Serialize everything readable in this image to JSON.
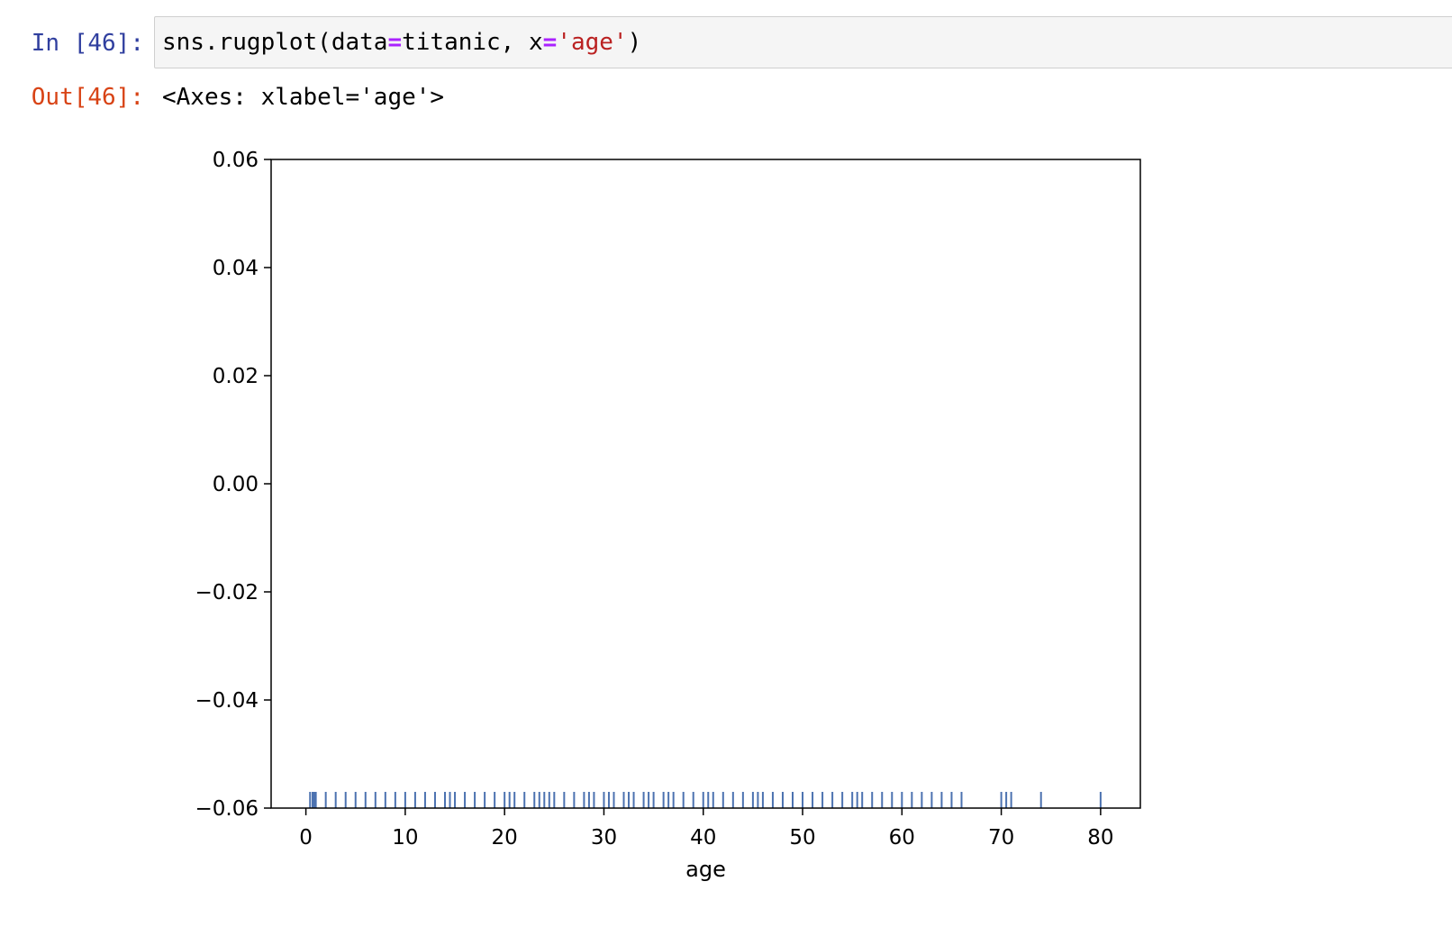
{
  "input_cell": {
    "prompt": "In [46]:",
    "code_tokens": [
      {
        "text": "sns.rugplot(data",
        "kind": "plain"
      },
      {
        "text": "=",
        "kind": "op"
      },
      {
        "text": "titanic, x",
        "kind": "plain"
      },
      {
        "text": "=",
        "kind": "op"
      },
      {
        "text": "'age'",
        "kind": "str"
      },
      {
        "text": ")",
        "kind": "plain"
      }
    ]
  },
  "output_cell": {
    "prompt": "Out[46]:",
    "text": "<Axes: xlabel='age'>"
  },
  "colors": {
    "in_prompt": "#303f9f",
    "out_prompt": "#d84315",
    "code_op": "#aa22ff",
    "code_str": "#ba2121",
    "rug": "#4c72b0"
  },
  "chart_data": {
    "type": "rug",
    "xlabel": "age",
    "ylabel": "",
    "xlim": [
      -3.5,
      84
    ],
    "ylim": [
      -0.06,
      0.06
    ],
    "x_ticks": [
      0,
      10,
      20,
      30,
      40,
      50,
      60,
      70,
      80
    ],
    "x_tick_labels": [
      "0",
      "10",
      "20",
      "30",
      "40",
      "50",
      "60",
      "70",
      "80"
    ],
    "y_ticks": [
      0.06,
      0.04,
      0.02,
      0.0,
      -0.02,
      -0.04,
      -0.06
    ],
    "y_tick_labels": [
      "0.06",
      "0.04",
      "0.02",
      "0.00",
      "−0.02",
      "−0.04",
      "−0.06"
    ],
    "grid": false,
    "rug_height_fraction": 0.025,
    "values": [
      0.42,
      0.67,
      0.75,
      0.83,
      0.92,
      1,
      2,
      3,
      4,
      5,
      6,
      7,
      8,
      9,
      10,
      11,
      12,
      13,
      14,
      14.5,
      15,
      16,
      17,
      18,
      19,
      20,
      20.5,
      21,
      22,
      23,
      23.5,
      24,
      24.5,
      25,
      26,
      27,
      28,
      28.5,
      29,
      30,
      30.5,
      31,
      32,
      32.5,
      33,
      34,
      34.5,
      35,
      36,
      36.5,
      37,
      38,
      39,
      40,
      40.5,
      41,
      42,
      43,
      44,
      45,
      45.5,
      46,
      47,
      48,
      49,
      50,
      51,
      52,
      53,
      54,
      55,
      55.5,
      56,
      57,
      58,
      59,
      60,
      61,
      62,
      63,
      64,
      65,
      66,
      70,
      70.5,
      71,
      74,
      80
    ]
  }
}
